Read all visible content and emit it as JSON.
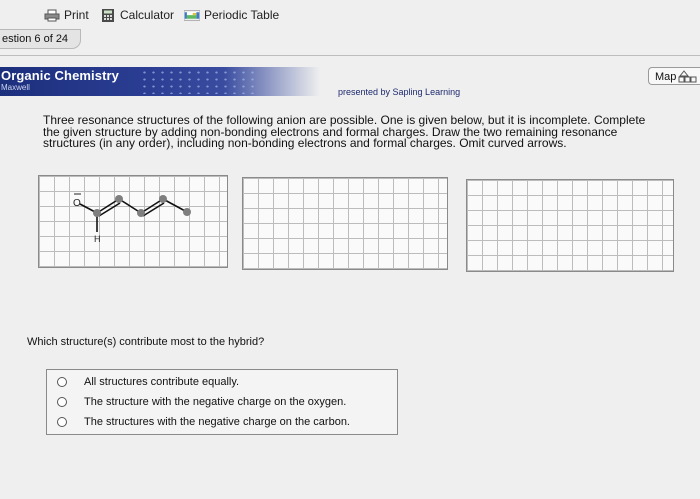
{
  "toolbar": {
    "print_label": "Print",
    "calculator_label": "Calculator",
    "periodic_table_label": "Periodic Table"
  },
  "question_tab": {
    "label": "estion 6 of 24"
  },
  "banner": {
    "title": "Organic Chemistry",
    "subtitle": "Maxwell",
    "presented_by": "presented by Sapling Learning",
    "map_label": "Map"
  },
  "instructions": "Three resonance structures of the following anion are possible. One is given below, but it is incomplete. Complete the given structure by adding non-bonding electrons and formal charges. Draw the two remaining resonance structures (in any order), including non-bonding electrons and formal charges. Omit curved arrows.",
  "structure": {
    "oxygen_label": "O",
    "hydrogen_label": "H"
  },
  "question": {
    "prompt": "Which structure(s) contribute most to the hybrid?",
    "options": [
      "All structures contribute equally.",
      "The structure with the negative charge on the oxygen.",
      "The structures with the negative charge on the carbon."
    ]
  },
  "colors": {
    "banner": "#1c2f7d",
    "atom_gray": "#7f7f7f"
  }
}
